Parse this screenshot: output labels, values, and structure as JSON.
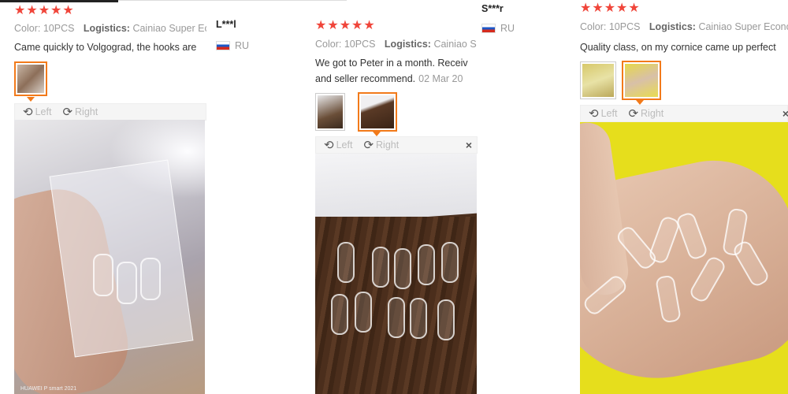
{
  "reviews": [
    {
      "color_label": "Color:",
      "color_value": "10PCS",
      "logistics_label": "Logistics:",
      "logistics_value": "Cainiao Super Ec",
      "text": "Came quickly to Volgograd, the hooks are",
      "date": ""
    },
    {
      "color_label": "Color:",
      "color_value": "10PCS",
      "logistics_label": "Logistics:",
      "logistics_value": "Cainiao S",
      "text": "We got to Peter in a month. Receiv",
      "text2": "and seller recommend.",
      "date": "02 Mar 20"
    },
    {
      "color_label": "Color:",
      "color_value": "10PCS",
      "logistics_label": "Logistics:",
      "logistics_value": "Cainiao Super Econo",
      "text": "Quality class, on my cornice came up perfect"
    }
  ],
  "users": [
    {
      "name": "L***l",
      "country": "RU"
    },
    {
      "name": "S***r",
      "country": "RU"
    }
  ],
  "controls": {
    "left_label": "Left",
    "right_label": "Right",
    "close_label": "×"
  },
  "photo_watermark": "HUAWEI P smart 2021",
  "rating_stars": "★★★★★",
  "colors": {
    "star": "#f0453a",
    "active_thumb": "#f27a1a",
    "photo3_bg": "#e8e020"
  }
}
